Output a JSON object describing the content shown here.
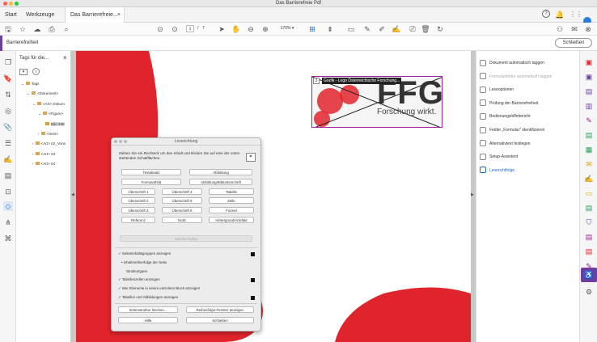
{
  "window": {
    "title": "Das Barrierefreie Pdf"
  },
  "tabs": {
    "start": "Start",
    "tools": "Werkzeuge",
    "doc": "Das Barrierefreie...",
    "close": "×"
  },
  "toolbar": {
    "page_current": "1",
    "page_sep": "/",
    "page_total": "7",
    "zoom": "170%"
  },
  "a11y_bar": {
    "title": "Barrierefreiheit",
    "close_label": "Schließen"
  },
  "tags_panel": {
    "title": "Tags für die...",
    "tree": [
      {
        "label": "Tags",
        "level": 0,
        "icon": "tag"
      },
      {
        "label": "<Dokument>",
        "level": 1,
        "icon": "tag"
      },
      {
        "label": "<Art> Dokum",
        "level": 2,
        "icon": "tag"
      },
      {
        "label": "<Figure>",
        "level": 3,
        "icon": "tag"
      },
      {
        "label": "Bild 255",
        "level": 4,
        "icon": "image"
      },
      {
        "label": "<Sect>",
        "level": 3,
        "icon": "tag"
      },
      {
        "label": "<Art> 02_Vorw",
        "level": 2,
        "icon": "tag"
      },
      {
        "label": "<Art> 03",
        "level": 2,
        "icon": "tag"
      },
      {
        "label": "<Art> 04",
        "level": 2,
        "icon": "tag"
      }
    ]
  },
  "document": {
    "figure_tooltip": "Grafik - Logo Österreichische Forschung...",
    "figure_number": "3",
    "logo_text": "FFG",
    "logo_sub": "Forschung wirkt."
  },
  "dialog": {
    "title": "Leserichtung",
    "instruction": "Ziehen Sie ein Rechteck um den Inhalt und klicken Sie auf eine der unten stehenden Schaltflächen.",
    "buttons": [
      [
        "Textabsatz",
        "Abbildung"
      ],
      [
        "Formularfeld",
        "Abbildung/Bildunterschrift"
      ],
      [
        "Überschrift 1",
        "Überschrift 4",
        "Tabelle"
      ],
      [
        "Überschrift 2",
        "Überschrift 5",
        "Zelle"
      ],
      [
        "Überschrift 3",
        "Überschrift 6",
        "Formel"
      ],
      [
        "Referenz",
        "Notiz",
        "Hintergrund/Artefakt"
      ]
    ],
    "table_editor": "Tabellen-Editor",
    "options": [
      {
        "label": "Seiteninhaltsgruppen anzeigen",
        "checked": true,
        "square": true
      },
      {
        "label": "Inhaltsreihenfolge der Seite",
        "checked": false,
        "bullet": true
      },
      {
        "label": "Strukturtypen",
        "checked": false
      },
      {
        "label": "Tabellenzellen anzeigen",
        "checked": true,
        "square": true
      },
      {
        "label": "Wie Elemente in einem einzelnen Block anzeigen",
        "checked": true
      },
      {
        "label": "Tabellen und Abbildungen anzeigen",
        "checked": true,
        "square": true
      }
    ],
    "bottom_buttons": [
      "Seitenstruktur löschen...",
      "Reihenfolge-Fenster anzeigen",
      "Hilfe",
      "Schließen"
    ]
  },
  "right_panel": {
    "items": [
      {
        "label": "Dokument automatisch taggen",
        "disabled": false
      },
      {
        "label": "Formularfelder automatisch taggen",
        "disabled": true
      },
      {
        "label": "Leseoptionen",
        "disabled": false
      },
      {
        "label": "Prüfung der Barrierefreiheit",
        "disabled": false
      },
      {
        "label": "Bedienungshilfebericht",
        "disabled": false
      },
      {
        "label": "Felder „Formular\" identifizieren",
        "disabled": false
      },
      {
        "label": "Alternativtext festlegen",
        "disabled": false
      },
      {
        "label": "Setup-Assistent",
        "disabled": false
      },
      {
        "label": "Leserichtfolge",
        "disabled": false,
        "active": true
      }
    ]
  },
  "colors": {
    "accent": "#6b3fa0",
    "brand_red": "#e0242b",
    "link_blue": "#1b6ac9"
  }
}
